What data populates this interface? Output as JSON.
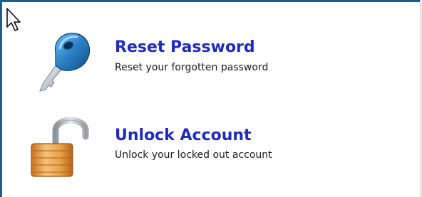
{
  "options": [
    {
      "title": "Reset Password",
      "description": "Reset your forgotten password",
      "icon": "key-icon"
    },
    {
      "title": "Unlock Account",
      "description": "Unlock your locked out account",
      "icon": "unlocked-padlock-icon"
    }
  ],
  "colors": {
    "title": "#1f2bbd",
    "frame": "#1f5f86",
    "key_blue": "#2a7fc4",
    "key_metal": "#c9cfd6",
    "lock_orange": "#e8a14a",
    "lock_shackle": "#b9bfc6"
  }
}
